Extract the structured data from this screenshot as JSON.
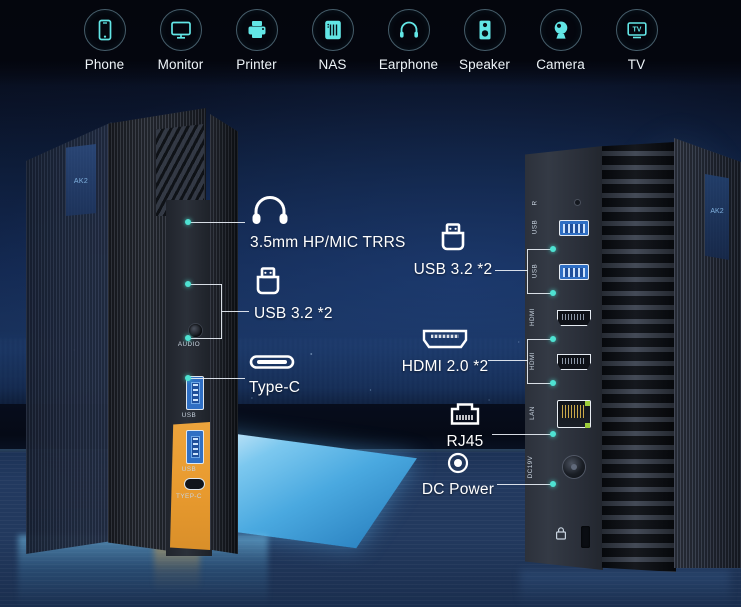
{
  "topbar": {
    "items": [
      {
        "label": "Phone",
        "icon": "phone-icon"
      },
      {
        "label": "Monitor",
        "icon": "monitor-icon"
      },
      {
        "label": "Printer",
        "icon": "printer-icon"
      },
      {
        "label": "NAS",
        "icon": "nas-icon"
      },
      {
        "label": "Earphone",
        "icon": "earphone-icon"
      },
      {
        "label": "Speaker",
        "icon": "speaker-icon"
      },
      {
        "label": "Camera",
        "icon": "camera-icon"
      },
      {
        "label": "TV",
        "icon": "tv-icon"
      }
    ]
  },
  "left_unit": {
    "brand_badge": "AK2",
    "port_labels": {
      "audio": "AUDIO",
      "usb_top": "USB",
      "usb_bottom": "USB",
      "typec": "TYEP-C"
    }
  },
  "right_unit": {
    "brand_badge": "AK2",
    "port_labels": {
      "reset": "R",
      "usb_top": "USB",
      "usb_bottom": "USB",
      "hdmi_top": "HDMI",
      "hdmi_bottom": "HDMI",
      "lan": "LAN",
      "dc": "DC19V"
    }
  },
  "callouts": {
    "front": [
      {
        "id": "audio",
        "label": "3.5mm HP/MIC TRRS",
        "icon": "headphone-icon"
      },
      {
        "id": "usb",
        "label": "USB 3.2 *2",
        "icon": "usb-icon"
      },
      {
        "id": "typec",
        "label": "Type-C",
        "icon": "typec-icon"
      }
    ],
    "rear": [
      {
        "id": "usb",
        "label": "USB 3.2 *2",
        "icon": "usb-icon"
      },
      {
        "id": "hdmi",
        "label": "HDMI 2.0 *2",
        "icon": "hdmi-icon"
      },
      {
        "id": "rj45",
        "label": "RJ45",
        "icon": "rj45-icon"
      },
      {
        "id": "power",
        "label": "DC Power",
        "icon": "dc-power-icon"
      }
    ]
  },
  "colors": {
    "icon_cyan": "#62E6E6",
    "node_teal": "#4EE2D2",
    "accent_orange": "#EDA43C",
    "sky_deep": "#05070F",
    "sky_mid": "#1B3663",
    "desk_blue": "#22395F",
    "text_white": "#FFFFFF"
  }
}
